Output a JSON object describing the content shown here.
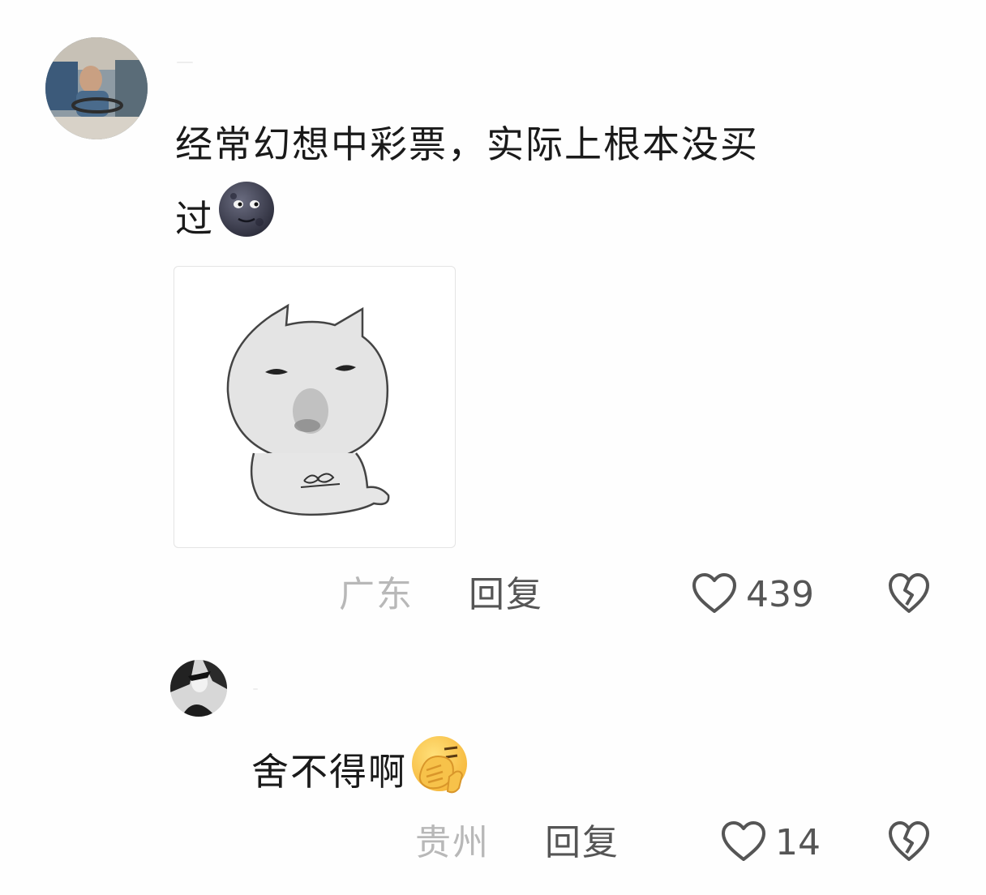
{
  "comments": [
    {
      "avatar": "avatar-driver",
      "text": "经常幻想中彩票，实际上根本没买",
      "text_line2": "过",
      "emoji": "new-moon-face-emoji",
      "sticker": "grey-cat-meme-sticker",
      "location": "广东",
      "reply_label": "回复",
      "likes": "439",
      "like_icon": "heart-outline-icon",
      "dislike_icon": "broken-heart-icon"
    },
    {
      "avatar": "avatar-bw-character",
      "text": "舍不得啊",
      "emoji": "face-palm-emoji",
      "location": "贵州",
      "reply_label": "回复",
      "likes": "14",
      "like_icon": "heart-outline-icon",
      "dislike_icon": "broken-heart-icon"
    }
  ],
  "colors": {
    "background": "#fefefe",
    "text": "#1a1a1a",
    "meta_location": "#b8b8b8",
    "meta_action": "#555555"
  }
}
